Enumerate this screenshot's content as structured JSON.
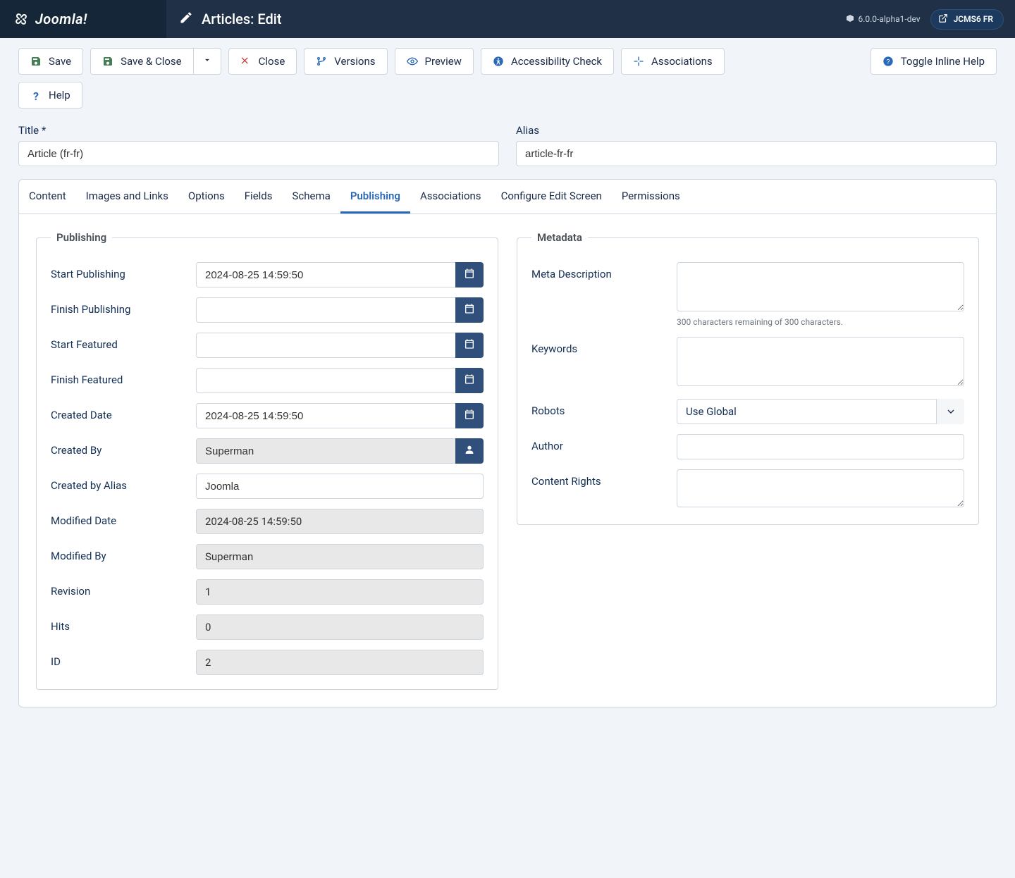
{
  "brand": {
    "name": "Joomla!"
  },
  "header": {
    "page_title": "Articles: Edit",
    "version": "6.0.0-alpha1-dev",
    "site_label": "JCMS6 FR"
  },
  "toolbar": {
    "save": "Save",
    "save_close": "Save & Close",
    "close": "Close",
    "versions": "Versions",
    "preview": "Preview",
    "accessibility": "Accessibility Check",
    "associations": "Associations",
    "inline_help": "Toggle Inline Help",
    "help": "Help"
  },
  "fields": {
    "title_label": "Title *",
    "title_value": "Article (fr-fr)",
    "alias_label": "Alias",
    "alias_value": "article-fr-fr"
  },
  "tabs": [
    {
      "key": "content",
      "label": "Content"
    },
    {
      "key": "images",
      "label": "Images and Links"
    },
    {
      "key": "options",
      "label": "Options"
    },
    {
      "key": "custom_fields",
      "label": "Fields"
    },
    {
      "key": "schema",
      "label": "Schema"
    },
    {
      "key": "publishing",
      "label": "Publishing",
      "active": true
    },
    {
      "key": "associations",
      "label": "Associations"
    },
    {
      "key": "configure",
      "label": "Configure Edit Screen"
    },
    {
      "key": "permissions",
      "label": "Permissions"
    }
  ],
  "publishing": {
    "legend": "Publishing",
    "start_publishing": {
      "label": "Start Publishing",
      "value": "2024-08-25 14:59:50"
    },
    "finish_publishing": {
      "label": "Finish Publishing",
      "value": ""
    },
    "start_featured": {
      "label": "Start Featured",
      "value": ""
    },
    "finish_featured": {
      "label": "Finish Featured",
      "value": ""
    },
    "created_date": {
      "label": "Created Date",
      "value": "2024-08-25 14:59:50"
    },
    "created_by": {
      "label": "Created By",
      "value": "Superman"
    },
    "created_by_alias": {
      "label": "Created by Alias",
      "value": "Joomla"
    },
    "modified_date": {
      "label": "Modified Date",
      "value": "2024-08-25 14:59:50"
    },
    "modified_by": {
      "label": "Modified By",
      "value": "Superman"
    },
    "revision": {
      "label": "Revision",
      "value": "1"
    },
    "hits": {
      "label": "Hits",
      "value": "0"
    },
    "id": {
      "label": "ID",
      "value": "2"
    }
  },
  "metadata": {
    "legend": "Metadata",
    "meta_description": {
      "label": "Meta Description",
      "value": "",
      "help": "300 characters remaining of 300 characters."
    },
    "keywords": {
      "label": "Keywords",
      "value": ""
    },
    "robots": {
      "label": "Robots",
      "selected": "Use Global"
    },
    "author": {
      "label": "Author",
      "value": ""
    },
    "content_rights": {
      "label": "Content Rights",
      "value": ""
    }
  }
}
